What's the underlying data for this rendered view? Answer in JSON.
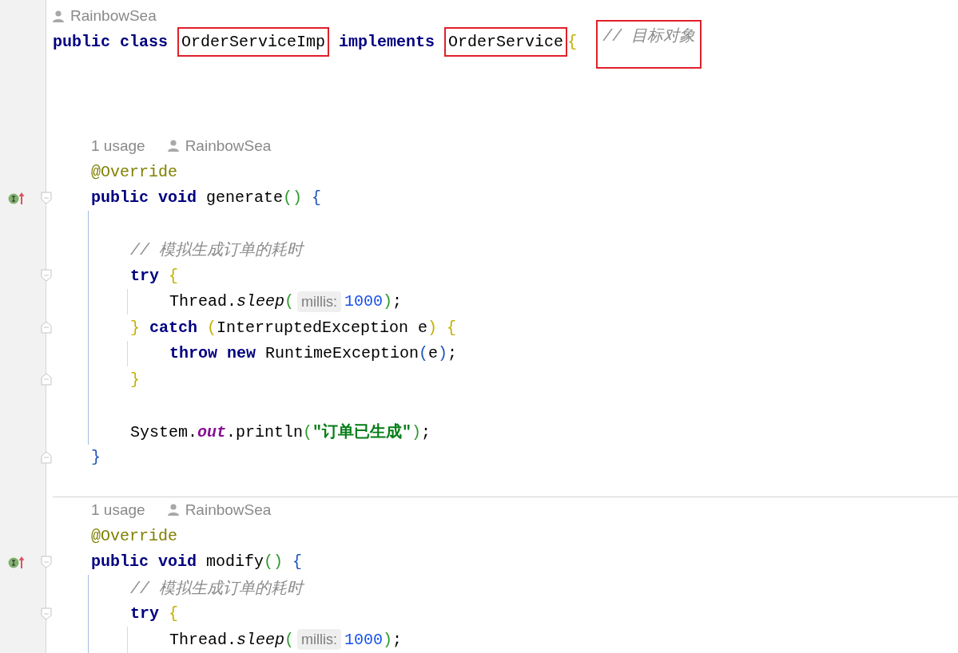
{
  "lines": [
    {
      "kind": "author",
      "author": "RainbowSea"
    },
    {
      "kind": "code",
      "tokens": [
        {
          "kind": "keyword",
          "text": "public class "
        },
        {
          "kind": "type",
          "text": "OrderServiceImp",
          "highlighted": true
        },
        {
          "kind": "keyword",
          "text": " implements "
        },
        {
          "kind": "type",
          "text": "OrderService",
          "highlighted": true
        },
        {
          "kind": "bracket",
          "text": "{",
          "color": "#c2b000"
        },
        {
          "kind": "comment",
          "text": "// 目标对象",
          "highlighted": true
        }
      ],
      "children": [
        {
          "kind": "blank"
        },
        {
          "kind": "blank"
        },
        {
          "kind": "blank"
        },
        {
          "kind": "usage",
          "usage": "1 usage",
          "author": "RainbowSea"
        },
        {
          "kind": "code",
          "tokens": [
            {
              "kind": "annotation",
              "text": "@Override"
            }
          ]
        },
        {
          "kind": "code",
          "fold_start": true,
          "implements_marker": true,
          "tokens": [
            {
              "kind": "keyword",
              "text": "public void "
            },
            {
              "kind": "plain",
              "text": "generate"
            },
            {
              "kind": "bracket",
              "text": "()",
              "color": "#2e9a2e"
            },
            {
              "kind": "bracket",
              "text": " {",
              "color": "#1c54b8"
            }
          ],
          "children": [
            {
              "kind": "blank"
            },
            {
              "kind": "code",
              "tokens": [
                {
                  "kind": "comment",
                  "text": "// 模拟生成订单的耗时"
                }
              ]
            },
            {
              "kind": "code",
              "fold_start": true,
              "tokens": [
                {
                  "kind": "keyword",
                  "text": "try"
                },
                {
                  "kind": "bracket",
                  "text": " {",
                  "color": "#c2b000"
                }
              ],
              "children": [
                {
                  "kind": "code",
                  "tokens": [
                    {
                      "kind": "plain",
                      "text": "Thread."
                    },
                    {
                      "kind": "static_method",
                      "text": "sleep"
                    },
                    {
                      "kind": "bracket",
                      "text": "(",
                      "color": "#2e9a2e"
                    },
                    {
                      "kind": "hint",
                      "text": "millis:"
                    },
                    {
                      "kind": "number",
                      "text": "1000"
                    },
                    {
                      "kind": "bracket",
                      "text": ")",
                      "color": "#2e9a2e"
                    },
                    {
                      "kind": "plain",
                      "text": ";"
                    }
                  ]
                }
              ]
            },
            {
              "kind": "code",
              "fold_end": true,
              "tokens": [
                {
                  "kind": "bracket",
                  "text": "} ",
                  "color": "#c2b000"
                },
                {
                  "kind": "keyword",
                  "text": "catch "
                },
                {
                  "kind": "bracket",
                  "text": "(",
                  "color": "#c2b000"
                },
                {
                  "kind": "plain",
                  "text": "InterruptedException e"
                },
                {
                  "kind": "bracket",
                  "text": ")",
                  "color": "#c2b000"
                },
                {
                  "kind": "bracket",
                  "text": " {",
                  "color": "#c2b000"
                }
              ],
              "children": [
                {
                  "kind": "code",
                  "tokens": [
                    {
                      "kind": "keyword",
                      "text": "throw new "
                    },
                    {
                      "kind": "plain",
                      "text": "RuntimeException"
                    },
                    {
                      "kind": "bracket",
                      "text": "(",
                      "color": "#1c54b8"
                    },
                    {
                      "kind": "plain",
                      "text": "e"
                    },
                    {
                      "kind": "bracket",
                      "text": ")",
                      "color": "#1c54b8"
                    },
                    {
                      "kind": "plain",
                      "text": ";"
                    }
                  ]
                }
              ]
            },
            {
              "kind": "code",
              "fold_end": true,
              "tokens": [
                {
                  "kind": "bracket",
                  "text": "}",
                  "color": "#c2b000"
                }
              ]
            },
            {
              "kind": "blank"
            },
            {
              "kind": "code",
              "tokens": [
                {
                  "kind": "plain",
                  "text": "System."
                },
                {
                  "kind": "static_field",
                  "text": "out"
                },
                {
                  "kind": "plain",
                  "text": ".println"
                },
                {
                  "kind": "bracket",
                  "text": "(",
                  "color": "#2e9a2e"
                },
                {
                  "kind": "string",
                  "text": "\"订单已生成\""
                },
                {
                  "kind": "bracket",
                  "text": ")",
                  "color": "#2e9a2e"
                },
                {
                  "kind": "plain",
                  "text": ";"
                }
              ]
            }
          ]
        },
        {
          "kind": "code",
          "fold_end": true,
          "tokens": [
            {
              "kind": "bracket",
              "text": "}",
              "color": "#1c54b8"
            }
          ]
        },
        {
          "kind": "blank"
        },
        {
          "kind": "separator"
        },
        {
          "kind": "usage",
          "usage": "1 usage",
          "author": "RainbowSea"
        },
        {
          "kind": "code",
          "tokens": [
            {
              "kind": "annotation",
              "text": "@Override"
            }
          ]
        },
        {
          "kind": "code",
          "fold_start": true,
          "implements_marker": true,
          "tokens": [
            {
              "kind": "keyword",
              "text": "public void "
            },
            {
              "kind": "plain",
              "text": "modify"
            },
            {
              "kind": "bracket",
              "text": "()",
              "color": "#2e9a2e"
            },
            {
              "kind": "bracket",
              "text": " {",
              "color": "#1c54b8"
            }
          ],
          "children": [
            {
              "kind": "code",
              "tokens": [
                {
                  "kind": "comment",
                  "text": "// 模拟生成订单的耗时"
                }
              ]
            },
            {
              "kind": "code",
              "fold_start": true,
              "tokens": [
                {
                  "kind": "keyword",
                  "text": "try"
                },
                {
                  "kind": "bracket",
                  "text": " {",
                  "color": "#c2b000"
                }
              ],
              "children": [
                {
                  "kind": "code",
                  "tokens": [
                    {
                      "kind": "plain",
                      "text": "Thread."
                    },
                    {
                      "kind": "static_method",
                      "text": "sleep"
                    },
                    {
                      "kind": "bracket",
                      "text": "(",
                      "color": "#2e9a2e"
                    },
                    {
                      "kind": "hint",
                      "text": "millis:"
                    },
                    {
                      "kind": "number",
                      "text": "1000"
                    },
                    {
                      "kind": "bracket",
                      "text": ")",
                      "color": "#2e9a2e"
                    },
                    {
                      "kind": "plain",
                      "text": ";"
                    }
                  ]
                }
              ]
            }
          ]
        }
      ]
    }
  ]
}
